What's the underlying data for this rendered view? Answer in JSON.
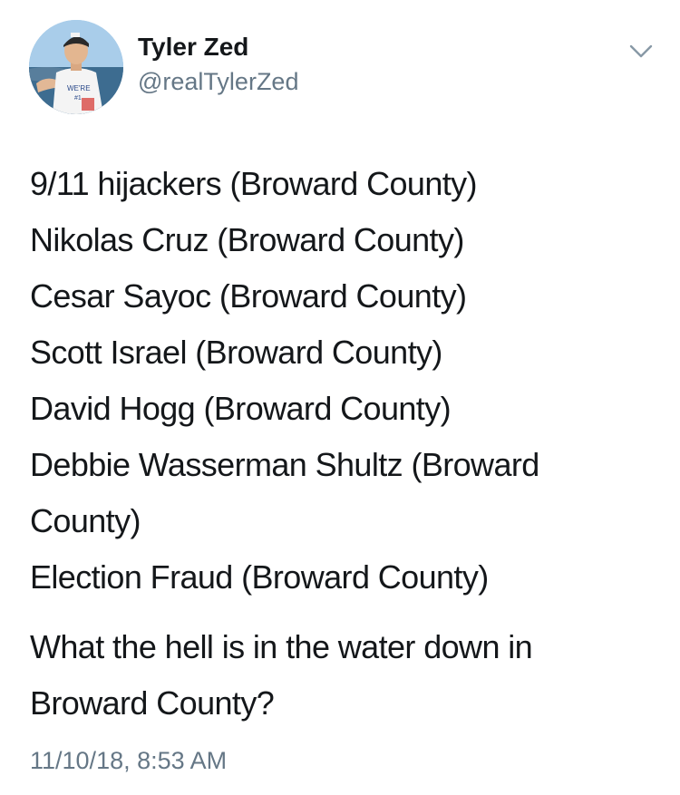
{
  "tweet": {
    "author": {
      "display_name": "Tyler Zed",
      "handle": "@realTylerZed",
      "avatar_icon": "user-avatar-photo"
    },
    "menu_icon": "chevron-down-icon",
    "lines": [
      "9/11 hijackers (Broward County)",
      "Nikolas Cruz (Broward County)",
      "Cesar Sayoc (Broward County)",
      "Scott Israel (Broward County)",
      "David Hogg (Broward County)",
      "Debbie Wasserman Shultz (Broward County)",
      "Election Fraud (Broward County)"
    ],
    "question": "What the hell is in the water down in Broward County?",
    "timestamp": "11/10/18, 8:53 AM"
  },
  "colors": {
    "text": "#14171a",
    "secondary_text": "#657786",
    "background": "#ffffff"
  }
}
